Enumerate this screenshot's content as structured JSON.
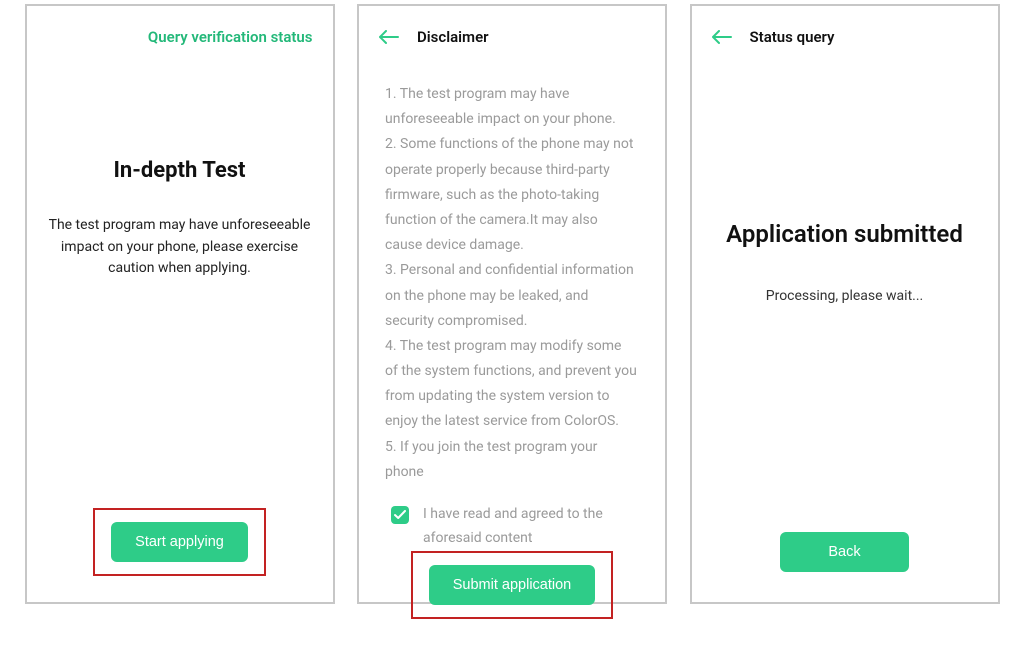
{
  "colors": {
    "accent": "#2ecc88",
    "highlight": "#c32222"
  },
  "screen1": {
    "topLink": "Query verification status",
    "title": "In-depth Test",
    "desc": "The test program may have unforeseeable impact on your phone, please exercise caution when applying.",
    "cta": "Start applying"
  },
  "screen2": {
    "title": "Disclaimer",
    "body": "1. The test program may have unforeseeable impact on your phone.\n2. Some functions of the phone may not operate properly because third-party firmware, such as the photo-taking function of the camera.It may also cause device damage.\n3. Personal and confidential information on the phone may be leaked, and security compromised.\n4. The test program may modify some of the system functions, and prevent you from updating the system version to enjoy the latest service from ColorOS.\n5. If you join the test program your phone",
    "agreeText": "I have read and agreed to the aforesaid content",
    "agreeChecked": true,
    "cta": "Submit application"
  },
  "screen3": {
    "title": "Status query",
    "heading": "Application submitted",
    "status": "Processing, please wait...",
    "cta": "Back"
  }
}
